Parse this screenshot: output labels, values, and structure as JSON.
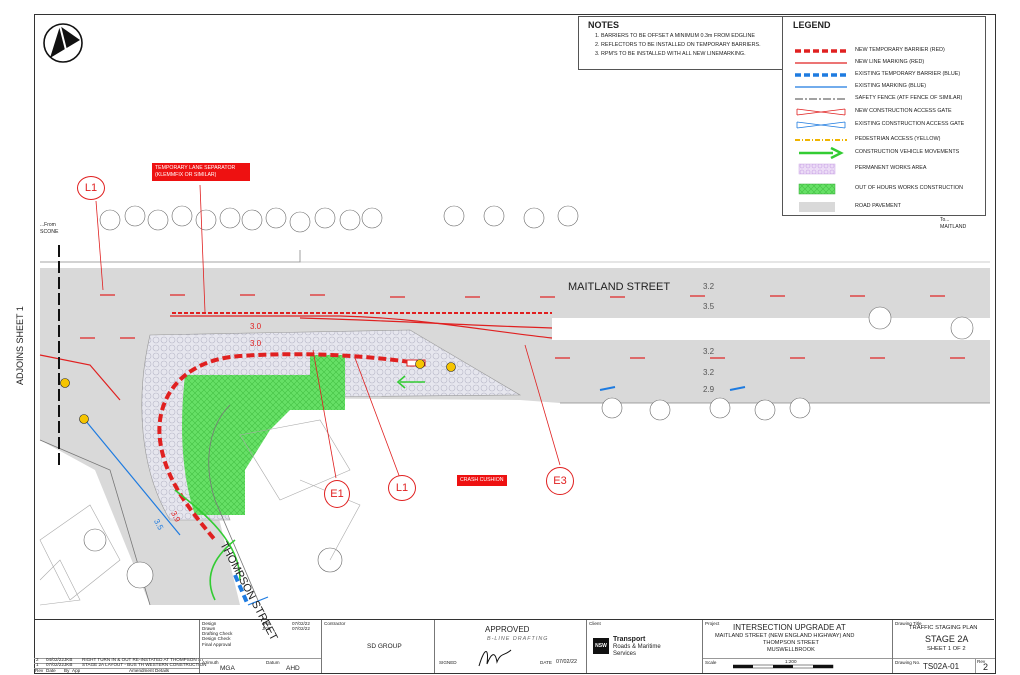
{
  "notes": {
    "title": "NOTES",
    "items": [
      "BARRIERS TO BE OFFSET A MINIMUM 0.3m FROM EDGLINE",
      "REFLECTORS TO BE INSTALLED ON TEMPORARY BARRIERS.",
      "RPM'S TO BE INSTALLED WITH ALL NEW LINEMARKING."
    ]
  },
  "legend": {
    "title": "LEGEND",
    "items": [
      {
        "label": "NEW TEMPORARY BARRIER (RED)",
        "symbol": "dash-thick",
        "color": "#e02020"
      },
      {
        "label": "NEW LINE MARKING (RED)",
        "symbol": "line",
        "color": "#e02020"
      },
      {
        "label": "EXISTING TEMPORARY BARRIER (BLUE)",
        "symbol": "dash-thick",
        "color": "#1e7be0"
      },
      {
        "label": "EXISTING MARKING (BLUE)",
        "symbol": "line",
        "color": "#1e7be0"
      },
      {
        "label": "SAFETY FENCE (ATF FENCE OF SIMILAR)",
        "symbol": "dashdot",
        "color": "#444444"
      },
      {
        "label": "NEW CONSTRUCTION ACCESS GATE",
        "symbol": "gate",
        "color": "#e02020"
      },
      {
        "label": "EXISTING CONSTRUCTION ACCESS GATE",
        "symbol": "gate",
        "color": "#1e7be0"
      },
      {
        "label": "PEDESTRIAN ACCESS (YELLOW)",
        "symbol": "dot-dash",
        "color": "#f0b400"
      },
      {
        "label": "CONSTRUCTION VEHICLE MOVEMENTS",
        "symbol": "arrow",
        "color": "#33cc33"
      },
      {
        "label": "PERMANENT WORKS AREA",
        "symbol": "hatch-purple",
        "color": "#c9a3e6"
      },
      {
        "label": "OUT OF HOURS WORKS CONSTRUCTION",
        "symbol": "hatch-green",
        "color": "#5fd35f"
      },
      {
        "label": "ROAD PAVEMENT",
        "symbol": "fill",
        "color": "#d9d9d9"
      }
    ]
  },
  "plan": {
    "street_main": "MAITLAND  STREET",
    "street_side": "THOMPSON STREET",
    "from_label": "...From",
    "from_place": "SCONE",
    "to_label": "To...",
    "to_place": "MAITLAND",
    "adjoins": "ADJOINS SHEET 1",
    "separator_label": "TEMPORARY LANE SEPARATOR (KLEMMFIX OR SIMILAR)",
    "crash_cushion": "CRASH CUSHION",
    "callouts": [
      "L1",
      "E1",
      "L1",
      "E3"
    ],
    "lane_widths": [
      "3.2",
      "3.5",
      "3.2",
      "3.2",
      "2.9",
      "3.0",
      "3.0",
      "3.9",
      "3.5"
    ]
  },
  "title_block": {
    "revisions": [
      {
        "rev": "2",
        "date": "04/02/22",
        "by": "JKB",
        "description": "RIGHT TURN IN & OUT RE-INSTATED AT THOMPSON ST"
      },
      {
        "rev": "1",
        "date": "07/02/22",
        "by": "JKB",
        "description": "STAGE 2A LAYOUT - BUS TH WESTERN CONSTRUCTION"
      }
    ],
    "rev_headers": [
      "Rev",
      "Date",
      "By",
      "App",
      "Amendment Details"
    ],
    "design_rows": [
      {
        "label": "Design",
        "name": "JKB",
        "date": "07/02/22"
      },
      {
        "label": "Drawn",
        "name": "JKB",
        "date": "07/02/22"
      },
      {
        "label": "Drafting Check",
        "name": "",
        "date": ""
      },
      {
        "label": "Design Check",
        "name": "",
        "date": ""
      },
      {
        "label": "Final Approval",
        "name": "",
        "date": ""
      }
    ],
    "azimuth_label": "Azimuth",
    "azimuth": "MGA",
    "datum_label": "Datum",
    "datum": "AHD",
    "contractor_label": "Contractor",
    "contractor": "SD GROUP",
    "approved": "APPROVED",
    "approved_by": "B-LINE DRAFTING",
    "signed_label": "SIGNED",
    "date_label": "DATE",
    "date": "07/02/22",
    "client_label": "Client",
    "client_logo": "NSW",
    "client_name_1": "Transport",
    "client_name_2": "Roads & Maritime",
    "client_name_3": "Services",
    "project_label": "Project",
    "project_title": "INTERSECTION UPGRADE AT",
    "project_line2": "MAITLAND STREET (NEW ENGLAND HIGHWAY) AND",
    "project_line3": "THOMPSON STREET",
    "project_line4": "MUSWELLBROOK",
    "scale_label": "Scale",
    "scale": "1:200",
    "drawing_title_label": "Drawing Title",
    "drawing_title_1": "TRAFFIC STAGING PLAN",
    "drawing_title_2": "STAGE 2A",
    "drawing_title_3": "SHEET 1 OF 2",
    "drawing_no_label": "Drawing No.",
    "drawing_no": "TS02A-01",
    "rev_label": "Rev",
    "rev": "2"
  }
}
